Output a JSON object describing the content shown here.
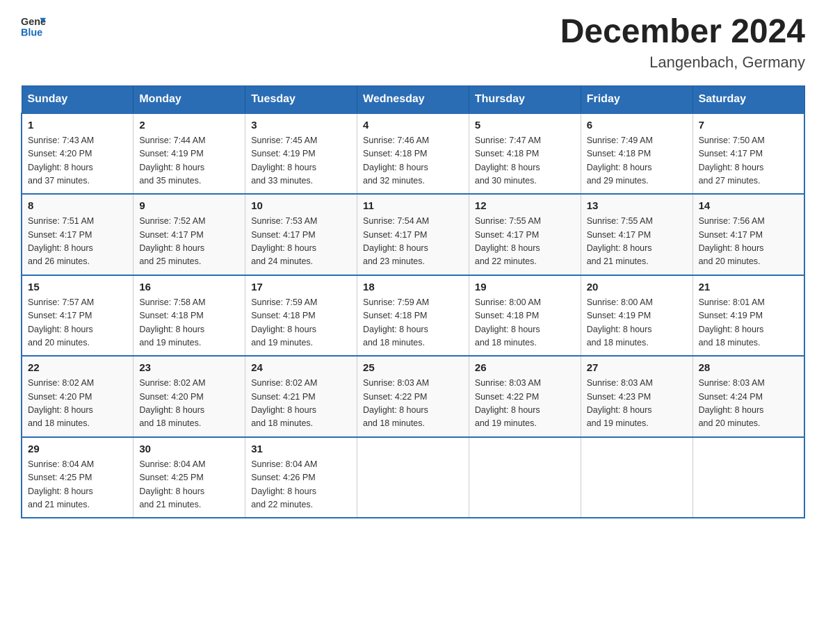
{
  "header": {
    "logo_line1": "General",
    "logo_line2": "Blue",
    "month_title": "December 2024",
    "location": "Langenbach, Germany"
  },
  "days_of_week": [
    "Sunday",
    "Monday",
    "Tuesday",
    "Wednesday",
    "Thursday",
    "Friday",
    "Saturday"
  ],
  "weeks": [
    [
      {
        "day": "1",
        "info": "Sunrise: 7:43 AM\nSunset: 4:20 PM\nDaylight: 8 hours\nand 37 minutes."
      },
      {
        "day": "2",
        "info": "Sunrise: 7:44 AM\nSunset: 4:19 PM\nDaylight: 8 hours\nand 35 minutes."
      },
      {
        "day": "3",
        "info": "Sunrise: 7:45 AM\nSunset: 4:19 PM\nDaylight: 8 hours\nand 33 minutes."
      },
      {
        "day": "4",
        "info": "Sunrise: 7:46 AM\nSunset: 4:18 PM\nDaylight: 8 hours\nand 32 minutes."
      },
      {
        "day": "5",
        "info": "Sunrise: 7:47 AM\nSunset: 4:18 PM\nDaylight: 8 hours\nand 30 minutes."
      },
      {
        "day": "6",
        "info": "Sunrise: 7:49 AM\nSunset: 4:18 PM\nDaylight: 8 hours\nand 29 minutes."
      },
      {
        "day": "7",
        "info": "Sunrise: 7:50 AM\nSunset: 4:17 PM\nDaylight: 8 hours\nand 27 minutes."
      }
    ],
    [
      {
        "day": "8",
        "info": "Sunrise: 7:51 AM\nSunset: 4:17 PM\nDaylight: 8 hours\nand 26 minutes."
      },
      {
        "day": "9",
        "info": "Sunrise: 7:52 AM\nSunset: 4:17 PM\nDaylight: 8 hours\nand 25 minutes."
      },
      {
        "day": "10",
        "info": "Sunrise: 7:53 AM\nSunset: 4:17 PM\nDaylight: 8 hours\nand 24 minutes."
      },
      {
        "day": "11",
        "info": "Sunrise: 7:54 AM\nSunset: 4:17 PM\nDaylight: 8 hours\nand 23 minutes."
      },
      {
        "day": "12",
        "info": "Sunrise: 7:55 AM\nSunset: 4:17 PM\nDaylight: 8 hours\nand 22 minutes."
      },
      {
        "day": "13",
        "info": "Sunrise: 7:55 AM\nSunset: 4:17 PM\nDaylight: 8 hours\nand 21 minutes."
      },
      {
        "day": "14",
        "info": "Sunrise: 7:56 AM\nSunset: 4:17 PM\nDaylight: 8 hours\nand 20 minutes."
      }
    ],
    [
      {
        "day": "15",
        "info": "Sunrise: 7:57 AM\nSunset: 4:17 PM\nDaylight: 8 hours\nand 20 minutes."
      },
      {
        "day": "16",
        "info": "Sunrise: 7:58 AM\nSunset: 4:18 PM\nDaylight: 8 hours\nand 19 minutes."
      },
      {
        "day": "17",
        "info": "Sunrise: 7:59 AM\nSunset: 4:18 PM\nDaylight: 8 hours\nand 19 minutes."
      },
      {
        "day": "18",
        "info": "Sunrise: 7:59 AM\nSunset: 4:18 PM\nDaylight: 8 hours\nand 18 minutes."
      },
      {
        "day": "19",
        "info": "Sunrise: 8:00 AM\nSunset: 4:18 PM\nDaylight: 8 hours\nand 18 minutes."
      },
      {
        "day": "20",
        "info": "Sunrise: 8:00 AM\nSunset: 4:19 PM\nDaylight: 8 hours\nand 18 minutes."
      },
      {
        "day": "21",
        "info": "Sunrise: 8:01 AM\nSunset: 4:19 PM\nDaylight: 8 hours\nand 18 minutes."
      }
    ],
    [
      {
        "day": "22",
        "info": "Sunrise: 8:02 AM\nSunset: 4:20 PM\nDaylight: 8 hours\nand 18 minutes."
      },
      {
        "day": "23",
        "info": "Sunrise: 8:02 AM\nSunset: 4:20 PM\nDaylight: 8 hours\nand 18 minutes."
      },
      {
        "day": "24",
        "info": "Sunrise: 8:02 AM\nSunset: 4:21 PM\nDaylight: 8 hours\nand 18 minutes."
      },
      {
        "day": "25",
        "info": "Sunrise: 8:03 AM\nSunset: 4:22 PM\nDaylight: 8 hours\nand 18 minutes."
      },
      {
        "day": "26",
        "info": "Sunrise: 8:03 AM\nSunset: 4:22 PM\nDaylight: 8 hours\nand 19 minutes."
      },
      {
        "day": "27",
        "info": "Sunrise: 8:03 AM\nSunset: 4:23 PM\nDaylight: 8 hours\nand 19 minutes."
      },
      {
        "day": "28",
        "info": "Sunrise: 8:03 AM\nSunset: 4:24 PM\nDaylight: 8 hours\nand 20 minutes."
      }
    ],
    [
      {
        "day": "29",
        "info": "Sunrise: 8:04 AM\nSunset: 4:25 PM\nDaylight: 8 hours\nand 21 minutes."
      },
      {
        "day": "30",
        "info": "Sunrise: 8:04 AM\nSunset: 4:25 PM\nDaylight: 8 hours\nand 21 minutes."
      },
      {
        "day": "31",
        "info": "Sunrise: 8:04 AM\nSunset: 4:26 PM\nDaylight: 8 hours\nand 22 minutes."
      },
      {
        "day": "",
        "info": ""
      },
      {
        "day": "",
        "info": ""
      },
      {
        "day": "",
        "info": ""
      },
      {
        "day": "",
        "info": ""
      }
    ]
  ]
}
